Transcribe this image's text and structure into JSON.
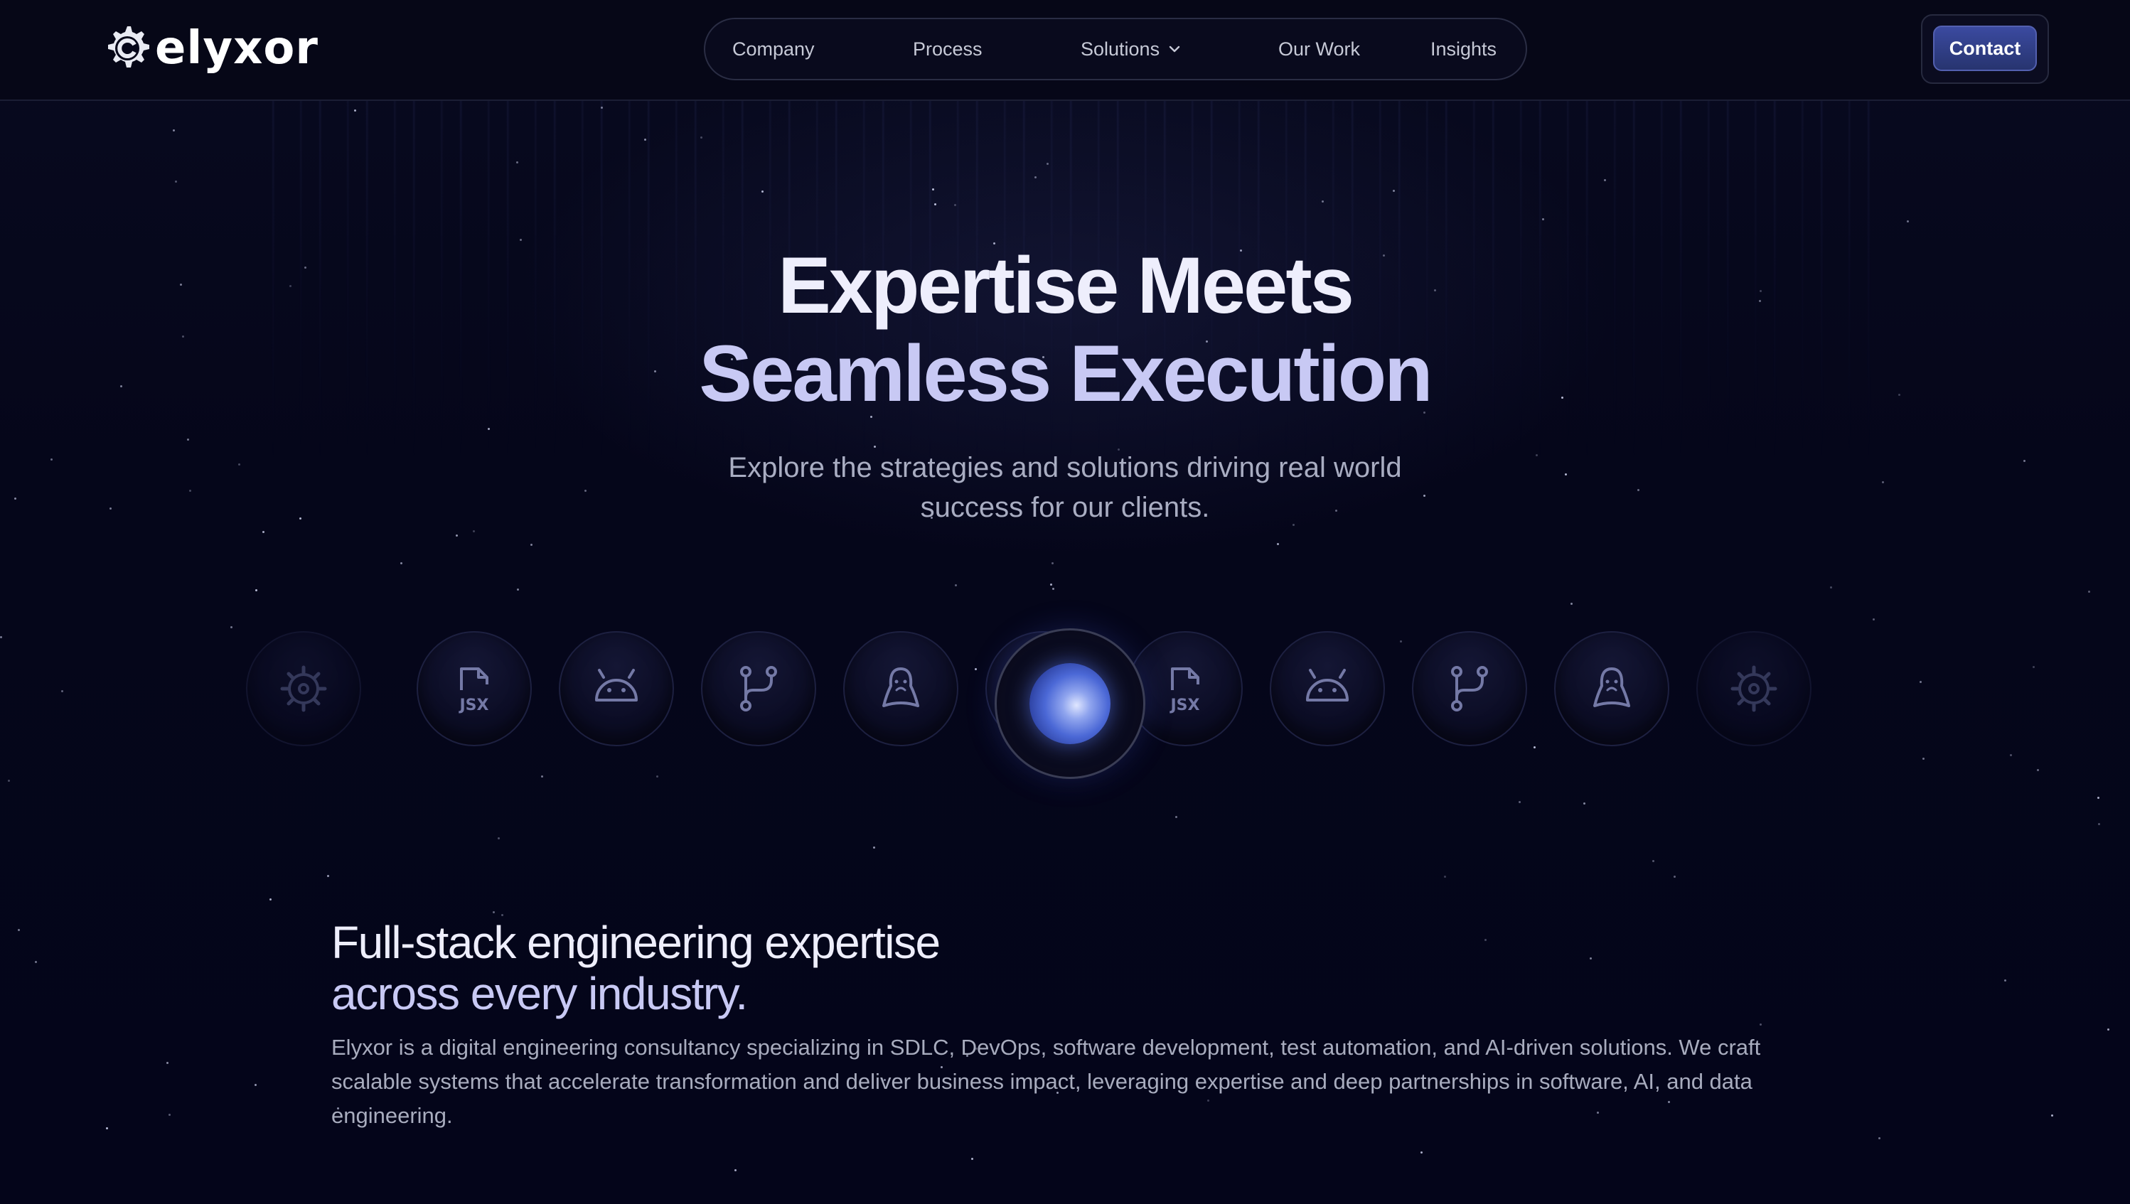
{
  "header": {
    "logo_text": "elyxor",
    "nav": [
      {
        "label": "Company"
      },
      {
        "label": "Process"
      },
      {
        "label": "Solutions"
      },
      {
        "label": "Our Work"
      },
      {
        "label": "Insights"
      }
    ],
    "contact_label": "Contact"
  },
  "hero": {
    "title_line1": "Expertise Meets",
    "title_line2": "Seamless Execution",
    "subtitle": "Explore the strategies and solutions driving real world success for our clients."
  },
  "carousel": {
    "icons": [
      "gear-icon",
      "jsx-file-icon",
      "android-icon",
      "git-branch-icon",
      "linux-icon",
      "jsx-file-icon",
      "android-icon",
      "git-branch-icon",
      "linux-icon",
      "gear-icon"
    ],
    "jsx_label": "JSX"
  },
  "about": {
    "title_line1": "Full-stack engineering expertise",
    "title_line2": "across every industry.",
    "body": "Elyxor is a digital engineering consultancy specializing in SDLC, DevOps, software development, test automation, and AI-driven solutions. We craft scalable systems that accelerate transformation and deliver business impact, leveraging expertise and deep partnerships in software, AI, and data engineering."
  },
  "colors": {
    "background": "#05061a",
    "accent": "#3b4aa0",
    "title": "#eeeefc",
    "title_secondary": "#c8c9f4",
    "body_text": "#a8acbe"
  }
}
